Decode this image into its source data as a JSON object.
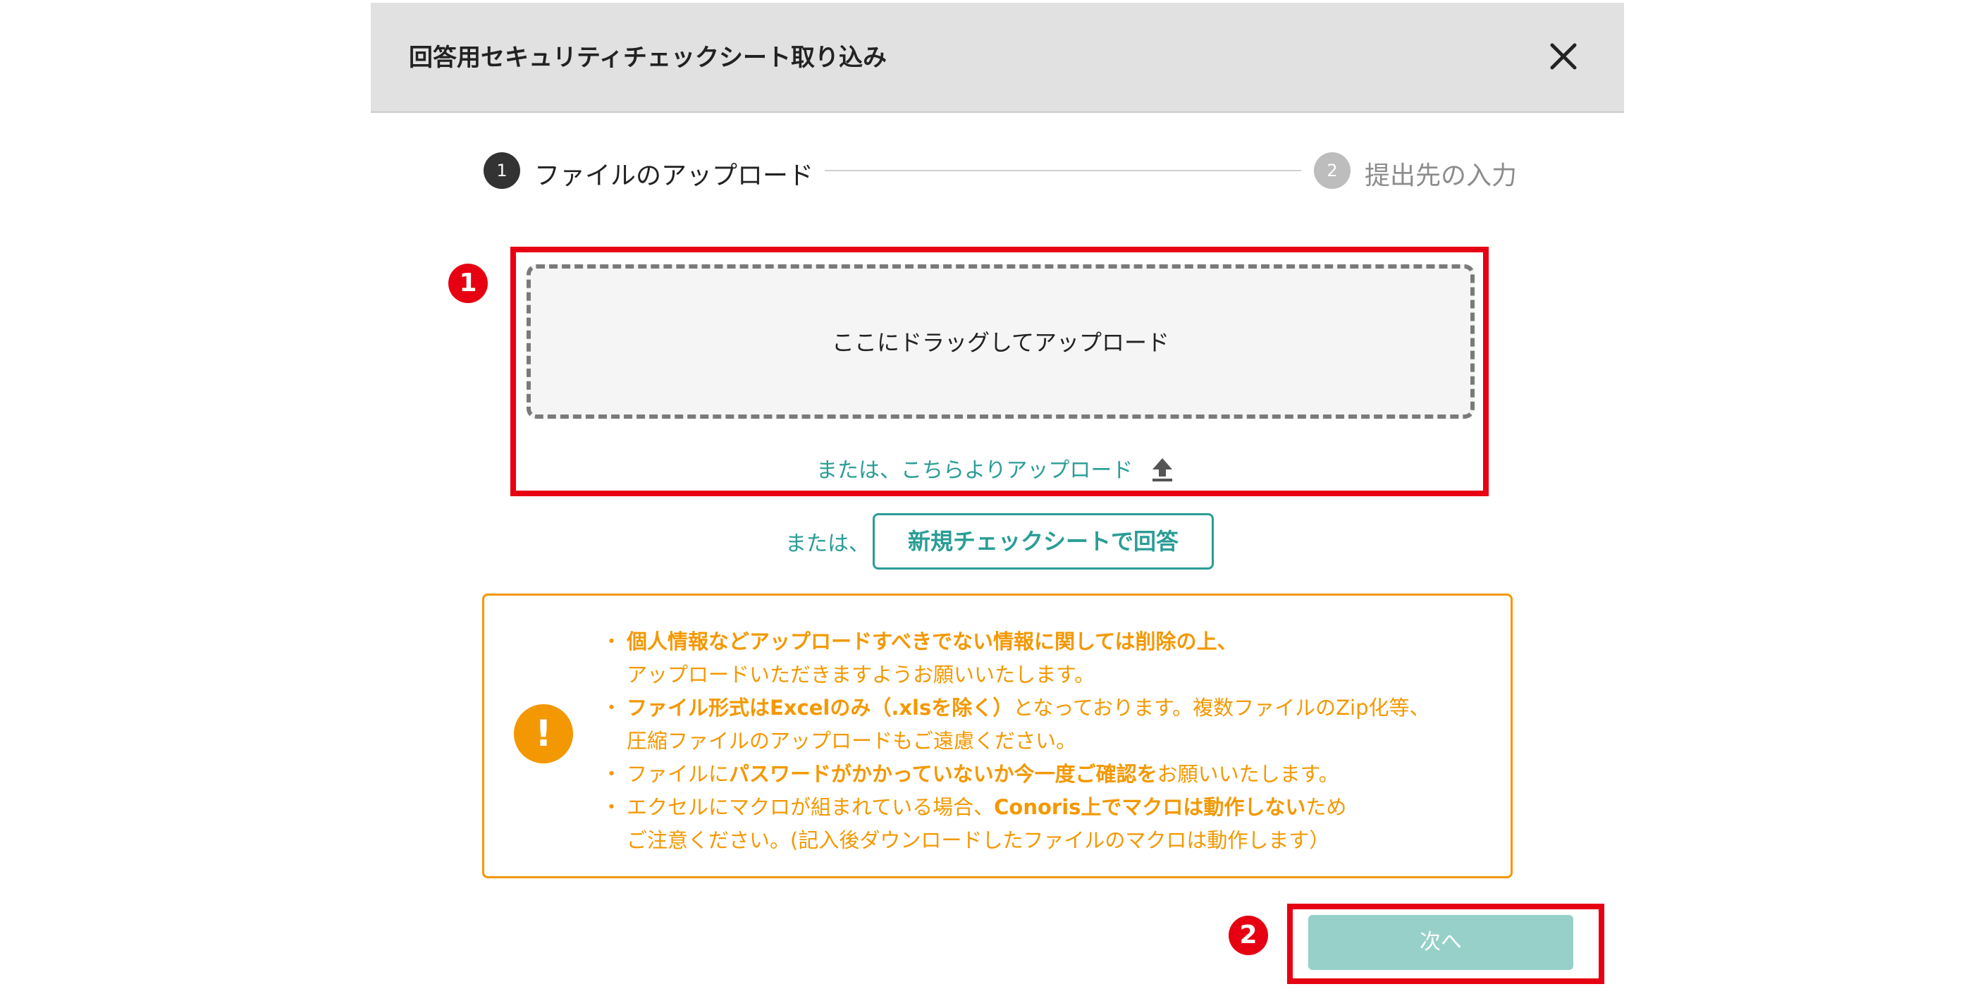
{
  "modal": {
    "title": "回答用セキュリティチェックシート取り込み",
    "close_icon": "close-icon"
  },
  "stepper": {
    "steps": [
      {
        "number": "1",
        "label": "ファイルのアップロード",
        "state": "active",
        "color": "#333333"
      },
      {
        "number": "2",
        "label": "提出先の入力",
        "state": "inactive",
        "color": "#bdbdbd"
      }
    ]
  },
  "annotations": {
    "marker1": "1",
    "marker2": "2",
    "color": "#e60012"
  },
  "upload": {
    "dropzone_text": "ここにドラッグしてアップロード",
    "link_text": "または、こちらよりアップロード",
    "upload_icon": "upload-icon",
    "alt_prefix": "または、",
    "new_sheet_label": "新規チェックシートで回答"
  },
  "notice": {
    "icon": "exclamation-icon",
    "items": [
      {
        "parts": [
          {
            "text": "個人情報などアップロードすべきでない情報に関しては削除の上、",
            "bold": true
          },
          {
            "text": "アップロードいただきますようお願いいたします。",
            "bold": false,
            "newline": true
          }
        ]
      },
      {
        "parts": [
          {
            "text": "ファイル形式はExcelのみ（.xlsを除く）",
            "bold": true
          },
          {
            "text": "となっております。複数ファイルのZip化等、",
            "bold": false
          },
          {
            "text": "圧縮ファイルのアップロードもご遠慮ください。",
            "bold": false,
            "newline": true
          }
        ]
      },
      {
        "parts": [
          {
            "text": "ファイルに",
            "bold": false
          },
          {
            "text": "パスワードがかかっていないか今一度ご確認を",
            "bold": true
          },
          {
            "text": "お願いいたします。",
            "bold": false
          }
        ]
      },
      {
        "parts": [
          {
            "text": "エクセルにマクロが組まれている場合、",
            "bold": false
          },
          {
            "text": "Conoris上でマクロは動作しない",
            "bold": true
          },
          {
            "text": "ため",
            "bold": false
          },
          {
            "text": "ご注意ください。(記入後ダウンロードしたファイルのマクロは動作します）",
            "bold": false,
            "newline": true
          }
        ]
      }
    ],
    "accent_color": "#f39800"
  },
  "footer": {
    "next_label": "次へ",
    "next_color": "#96d0c9"
  },
  "colors": {
    "teal": "#2a9d96",
    "header_bg": "#e1e1e1"
  }
}
